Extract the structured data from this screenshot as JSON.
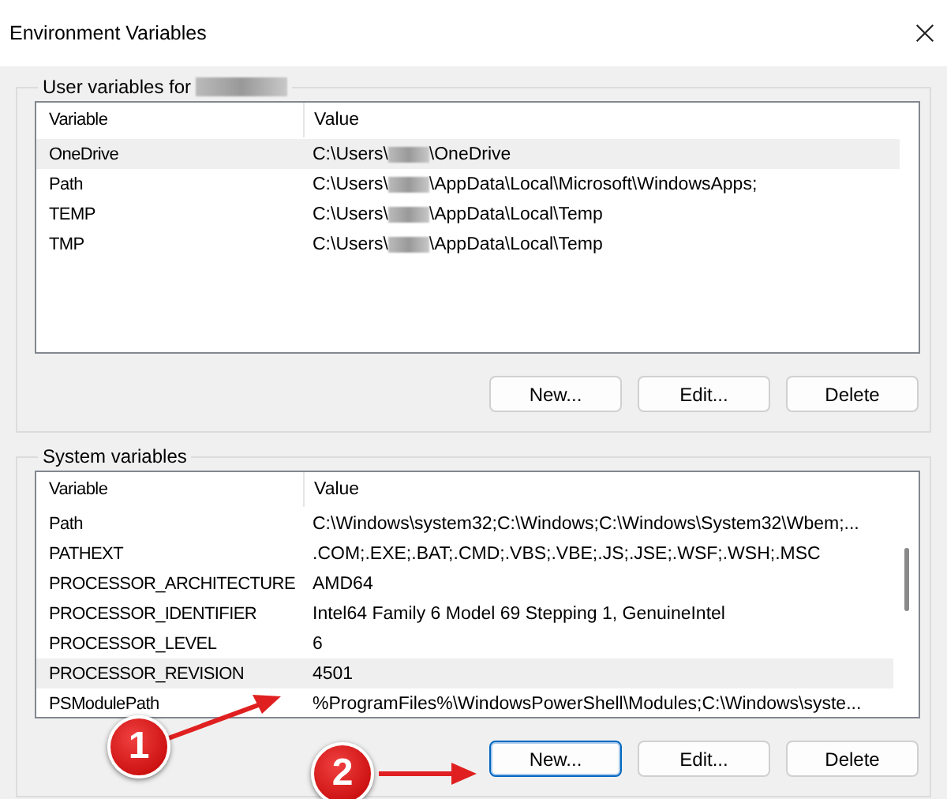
{
  "window": {
    "title": "Environment Variables"
  },
  "user_variables": {
    "label": "User variables for",
    "label_redacted": true,
    "columns": [
      "Variable",
      "Value"
    ],
    "rows": [
      {
        "variable": "OneDrive",
        "value_prefix": "C:\\Users\\",
        "value_redacted": true,
        "value_suffix": "\\OneDrive",
        "selected": true
      },
      {
        "variable": "Path",
        "value_prefix": "C:\\Users\\",
        "value_redacted": true,
        "value_suffix": "\\AppData\\Local\\Microsoft\\WindowsApps;",
        "selected": false
      },
      {
        "variable": "TEMP",
        "value_prefix": "C:\\Users\\",
        "value_redacted": true,
        "value_suffix": "\\AppData\\Local\\Temp",
        "selected": false
      },
      {
        "variable": "TMP",
        "value_prefix": "C:\\Users\\",
        "value_redacted": true,
        "value_suffix": "\\AppData\\Local\\Temp",
        "selected": false
      }
    ],
    "buttons": [
      {
        "label": "New...",
        "focused": false
      },
      {
        "label": "Edit...",
        "focused": false
      },
      {
        "label": "Delete",
        "focused": false
      }
    ]
  },
  "system_variables": {
    "label": "System variables",
    "columns": [
      "Variable",
      "Value"
    ],
    "rows": [
      {
        "variable": "Path",
        "value": "C:\\Windows\\system32;C:\\Windows;C:\\Windows\\System32\\Wbem;...",
        "selected": false
      },
      {
        "variable": "PATHEXT",
        "value": ".COM;.EXE;.BAT;.CMD;.VBS;.VBE;.JS;.JSE;.WSF;.WSH;.MSC",
        "selected": false
      },
      {
        "variable": "PROCESSOR_ARCHITECTURE",
        "value": "AMD64",
        "selected": false
      },
      {
        "variable": "PROCESSOR_IDENTIFIER",
        "value": "Intel64 Family 6 Model 69 Stepping 1, GenuineIntel",
        "selected": false
      },
      {
        "variable": "PROCESSOR_LEVEL",
        "value": "6",
        "selected": false
      },
      {
        "variable": "PROCESSOR_REVISION",
        "value": "4501",
        "selected": true
      },
      {
        "variable": "PSModulePath",
        "value": "%ProgramFiles%\\WindowsPowerShell\\Modules;C:\\Windows\\syste...",
        "selected": false
      }
    ],
    "buttons": [
      {
        "label": "New...",
        "focused": true
      },
      {
        "label": "Edit...",
        "focused": false
      },
      {
        "label": "Delete",
        "focused": false
      }
    ]
  },
  "callouts": [
    {
      "number": "1"
    },
    {
      "number": "2"
    }
  ]
}
